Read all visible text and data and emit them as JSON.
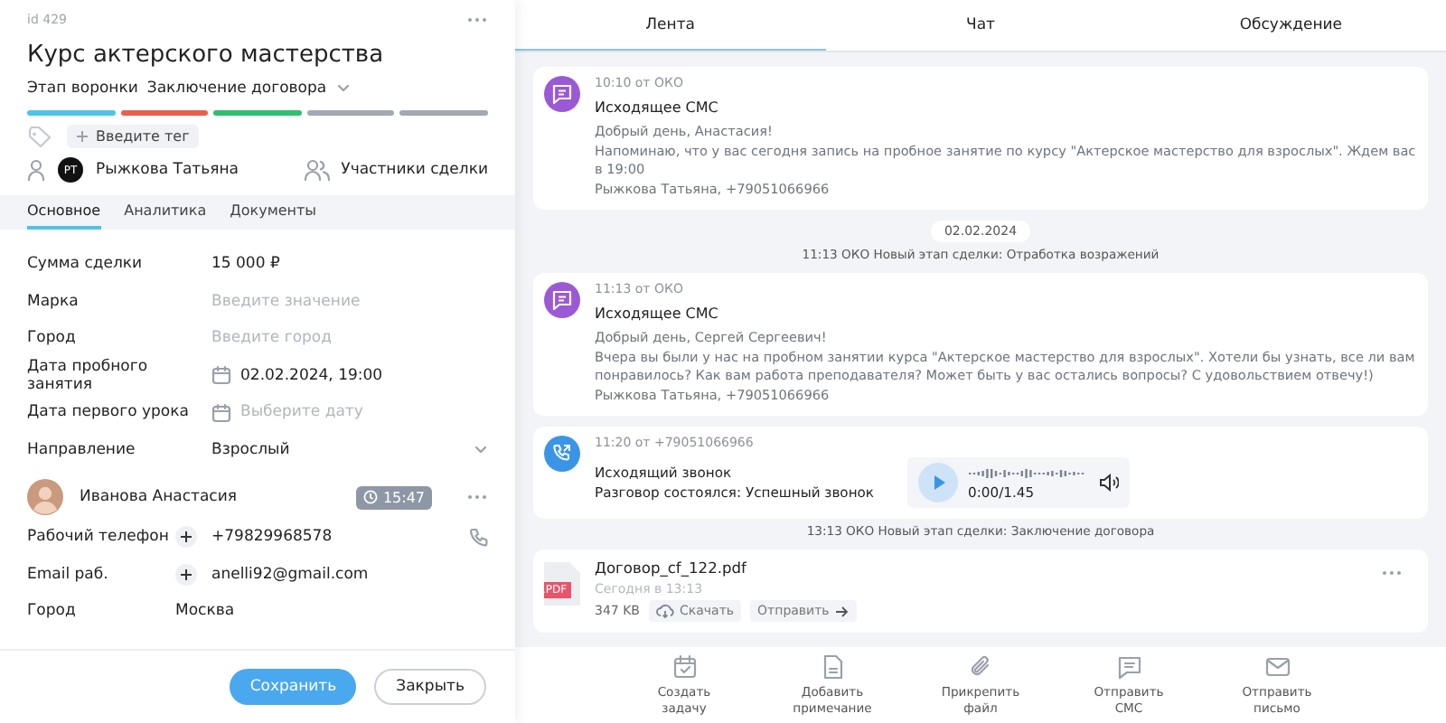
{
  "deal": {
    "id": "id 429",
    "title": "Курс актерского мастерства",
    "stage_label": "Этап воронки",
    "stage": "Заключение договора",
    "stages": [
      {
        "color": "#4fc3e8"
      },
      {
        "color": "#e8604c"
      },
      {
        "color": "#2fbf71"
      },
      {
        "color": "#a3a8b3"
      },
      {
        "color": "#a3a8b3"
      }
    ],
    "tag_placeholder": "Введите тег",
    "responsible": {
      "initials": "РТ",
      "name": "Рыжкова Татьяна"
    },
    "participants": "Участники сделки"
  },
  "left_tabs": [
    {
      "label": "Основное",
      "selected": true
    },
    {
      "label": "Аналитика",
      "selected": false
    },
    {
      "label": "Документы",
      "selected": false
    }
  ],
  "fields": [
    {
      "kind": "text",
      "label": "Сумма сделки",
      "value": "15 000 ₽"
    },
    {
      "kind": "text",
      "label": "Марка",
      "placeholder": "Введите значение"
    },
    {
      "kind": "text",
      "label": "Город",
      "placeholder": "Введите город"
    },
    {
      "kind": "date",
      "label": "Дата пробного занятия",
      "value": "02.02.2024, 19:00"
    },
    {
      "kind": "date",
      "label": "Дата первого урока",
      "placeholder": "Выберите дату"
    },
    {
      "kind": "select",
      "label": "Направление",
      "value": "Взрослый"
    }
  ],
  "contact": {
    "name": "Иванова Анастасия",
    "time": "15:47",
    "fields": [
      {
        "kind": "phone",
        "label": "Рабочий телефон",
        "value": "+79829968578"
      },
      {
        "kind": "email",
        "label": "Email раб.",
        "value": "anelli92@gmail.com"
      },
      {
        "kind": "text",
        "label": "Город",
        "value": "Москва"
      }
    ]
  },
  "buttons": [
    {
      "kind": "primary",
      "label": "Сохранить"
    },
    {
      "kind": "secondary",
      "label": "Закрыть"
    }
  ],
  "right_tabs": [
    {
      "label": "Лента",
      "selected": true
    },
    {
      "label": "Чат",
      "selected": false
    },
    {
      "label": "Обсуждение",
      "selected": false
    }
  ],
  "feed": [
    {
      "kind": "sms",
      "meta": "10:10 от ОКО",
      "title": "Исходящее СМС",
      "lines": [
        "Добрый день, Анастасия!",
        "Напоминаю, что у вас сегодня запись на пробное занятие по курсу \"Актерское мастерство для взрослых\". Ждем вас в 19:00",
        "Рыжкова Татьяна, +79051066966"
      ]
    },
    {
      "kind": "date",
      "text": "02.02.2024"
    },
    {
      "kind": "event",
      "text": "11:13 ОКО Новый этап сделки: Отработка возражений"
    },
    {
      "kind": "sms",
      "meta": "11:13 от ОКО",
      "title": "Исходящее СМС",
      "lines": [
        "Добрый день, Сергей Сергеевич!",
        "Вчера вы были у нас на пробном занятии курса \"Актерское мастерство для взрослых\". Хотели бы узнать, все ли вам понравилось? Как вам работа преподавателя? Может быть у вас остались вопросы? С удовольствием отвечу!)",
        "Рыжкова Татьяна, +79051066966"
      ]
    },
    {
      "kind": "call",
      "meta": "11:20 от +79051066966",
      "title": "Исходящий звонок",
      "status": "Разговор состоялся: Успешный звонок",
      "duration": "0:00/1.45"
    },
    {
      "kind": "event",
      "text": "13:13 ОКО Новый этап сделки: Заключение договора"
    },
    {
      "kind": "file",
      "name": "Договор_cf_122.pdf",
      "badge": ".PDF",
      "date": "Сегодня в 13:13",
      "size": "347 KB",
      "download": "Скачать",
      "send": "Отправить"
    }
  ],
  "actions": [
    {
      "kind": "task",
      "label": "Создать задачу"
    },
    {
      "kind": "note",
      "label": "Добавить примечание"
    },
    {
      "kind": "attach",
      "label": "Прикрепить файл"
    },
    {
      "kind": "sms",
      "label": "Отправить СМС"
    },
    {
      "kind": "mail",
      "label": "Отправить письмо"
    }
  ]
}
